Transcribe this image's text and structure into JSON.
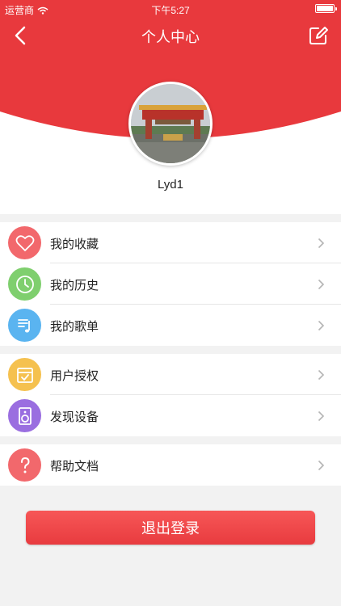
{
  "status_bar": {
    "carrier": "运营商",
    "time": "下午5:27"
  },
  "nav": {
    "title": "个人中心"
  },
  "profile": {
    "username": "Lyd1"
  },
  "menu_groups": [
    [
      {
        "label": "我的收藏",
        "icon": "heart-icon",
        "color": "#f2686c"
      },
      {
        "label": "我的历史",
        "icon": "clock-icon",
        "color": "#7fcf6e"
      },
      {
        "label": "我的歌单",
        "icon": "playlist-icon",
        "color": "#5ab4f0"
      }
    ],
    [
      {
        "label": "用户授权",
        "icon": "calendar-check-icon",
        "color": "#f5c14f"
      },
      {
        "label": "发现设备",
        "icon": "speaker-icon",
        "color": "#9a6ee0"
      }
    ],
    [
      {
        "label": "帮助文档",
        "icon": "question-icon",
        "color": "#f2686c"
      }
    ]
  ],
  "logout_label": "退出登录",
  "colors": {
    "brand_red": "#e8393d"
  }
}
